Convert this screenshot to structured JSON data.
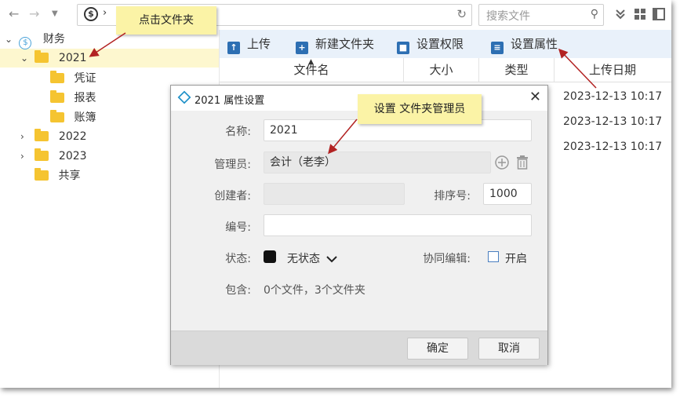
{
  "toolbar": {
    "search_placeholder": "搜索文件",
    "upload": "上传",
    "new_folder": "新建文件夹",
    "permissions": "设置权限",
    "properties": "设置属性"
  },
  "address": {
    "separator": "›"
  },
  "sidebar": {
    "root": "财务",
    "items": [
      {
        "label": "2021"
      },
      {
        "label": "凭证"
      },
      {
        "label": "报表"
      },
      {
        "label": "账簿"
      },
      {
        "label": "2022"
      },
      {
        "label": "2023"
      },
      {
        "label": "共享"
      }
    ]
  },
  "table": {
    "columns": [
      "文件名",
      "大小",
      "类型",
      "上传日期"
    ],
    "dates": [
      "2023-12-13 10:17",
      "2023-12-13 10:17",
      "2023-12-13 10:17"
    ]
  },
  "dialog": {
    "title": "2021 属性设置",
    "name_label": "名称:",
    "name_value": "2021",
    "admin_label": "管理员:",
    "admin_value": "会计（老李）",
    "creator_label": "创建者:",
    "creator_value": "",
    "sort_label": "排序号:",
    "sort_value": "1000",
    "code_label": "编号:",
    "code_value": "",
    "status_label": "状态:",
    "status_value": "无状态",
    "coedit_label": "协同编辑:",
    "coedit_value": "开启",
    "contains_label": "包含:",
    "contains_value": "0个文件，3个文件夹",
    "ok": "确定",
    "cancel": "取消"
  },
  "callouts": {
    "click_folder": "点击文件夹",
    "set_admin": "设置 文件夹管理员"
  },
  "colors": {
    "accent": "#2d6fb3",
    "selected_row": "#fdf7cf",
    "callout": "#fbf3a6",
    "arrow": "#b22222"
  }
}
